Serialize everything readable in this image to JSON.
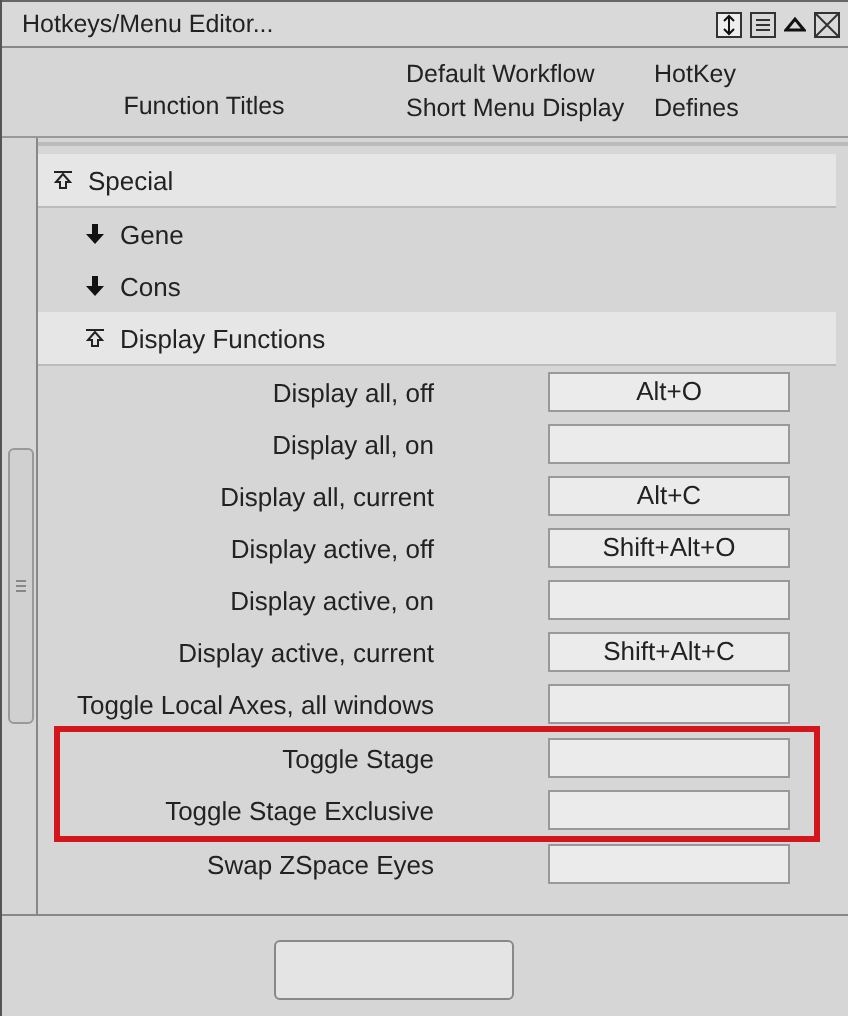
{
  "window": {
    "title": "Hotkeys/Menu Editor..."
  },
  "columns": [
    "Function Titles",
    "Default Workflow\nShort Menu Display",
    "HotKey\nDefines"
  ],
  "tree": [
    {
      "label": "Special",
      "expanded": true,
      "children": [
        {
          "label": "Gene",
          "expanded": false
        },
        {
          "label": "Cons",
          "expanded": false
        },
        {
          "label": "Display Functions",
          "expanded": true,
          "functions": [
            {
              "label": "Display all, off",
              "hotkey": "Alt+O",
              "highlighted": false
            },
            {
              "label": "Display all, on",
              "highlighted": false
            },
            {
              "label": "Display all, current",
              "hotkey": "Alt+C",
              "highlighted": false
            },
            {
              "label": "Display active, off",
              "hotkey": "Shift+Alt+O",
              "highlighted": false
            },
            {
              "label": "Display active, on",
              "highlighted": false
            },
            {
              "label": "Display active, current",
              "hotkey": "Shift+Alt+C",
              "highlighted": false
            },
            {
              "label": "Toggle Local Axes, all windows",
              "highlighted": false
            },
            {
              "label": "Toggle Stage",
              "highlighted": true
            },
            {
              "label": "Toggle Stage Exclusive",
              "highlighted": true
            },
            {
              "label": "Swap ZSpace Eyes",
              "highlighted": false
            }
          ]
        }
      ]
    }
  ]
}
